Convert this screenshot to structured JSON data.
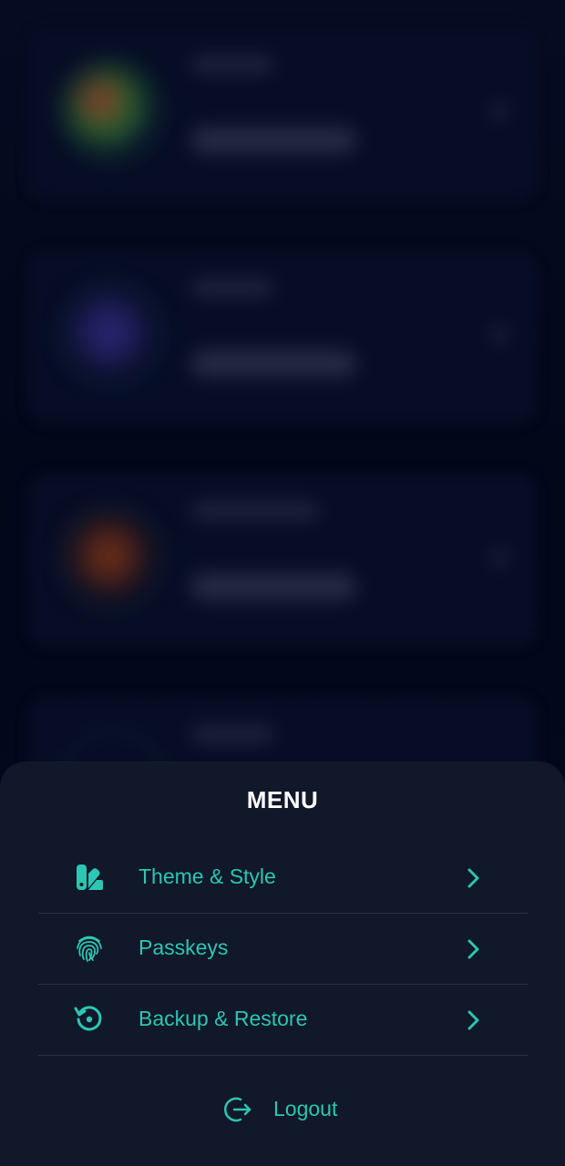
{
  "menu": {
    "title": "MENU",
    "items": [
      {
        "label": "Theme & Style",
        "icon": "palette-icon"
      },
      {
        "label": "Passkeys",
        "icon": "fingerprint-icon"
      },
      {
        "label": "Backup & Restore",
        "icon": "restore-icon"
      }
    ],
    "logout_label": "Logout"
  },
  "colors": {
    "accent": "#2cc6b3",
    "sheet_bg": "#101829",
    "page_bg": "#050a1e",
    "divider": "#2a3344"
  }
}
